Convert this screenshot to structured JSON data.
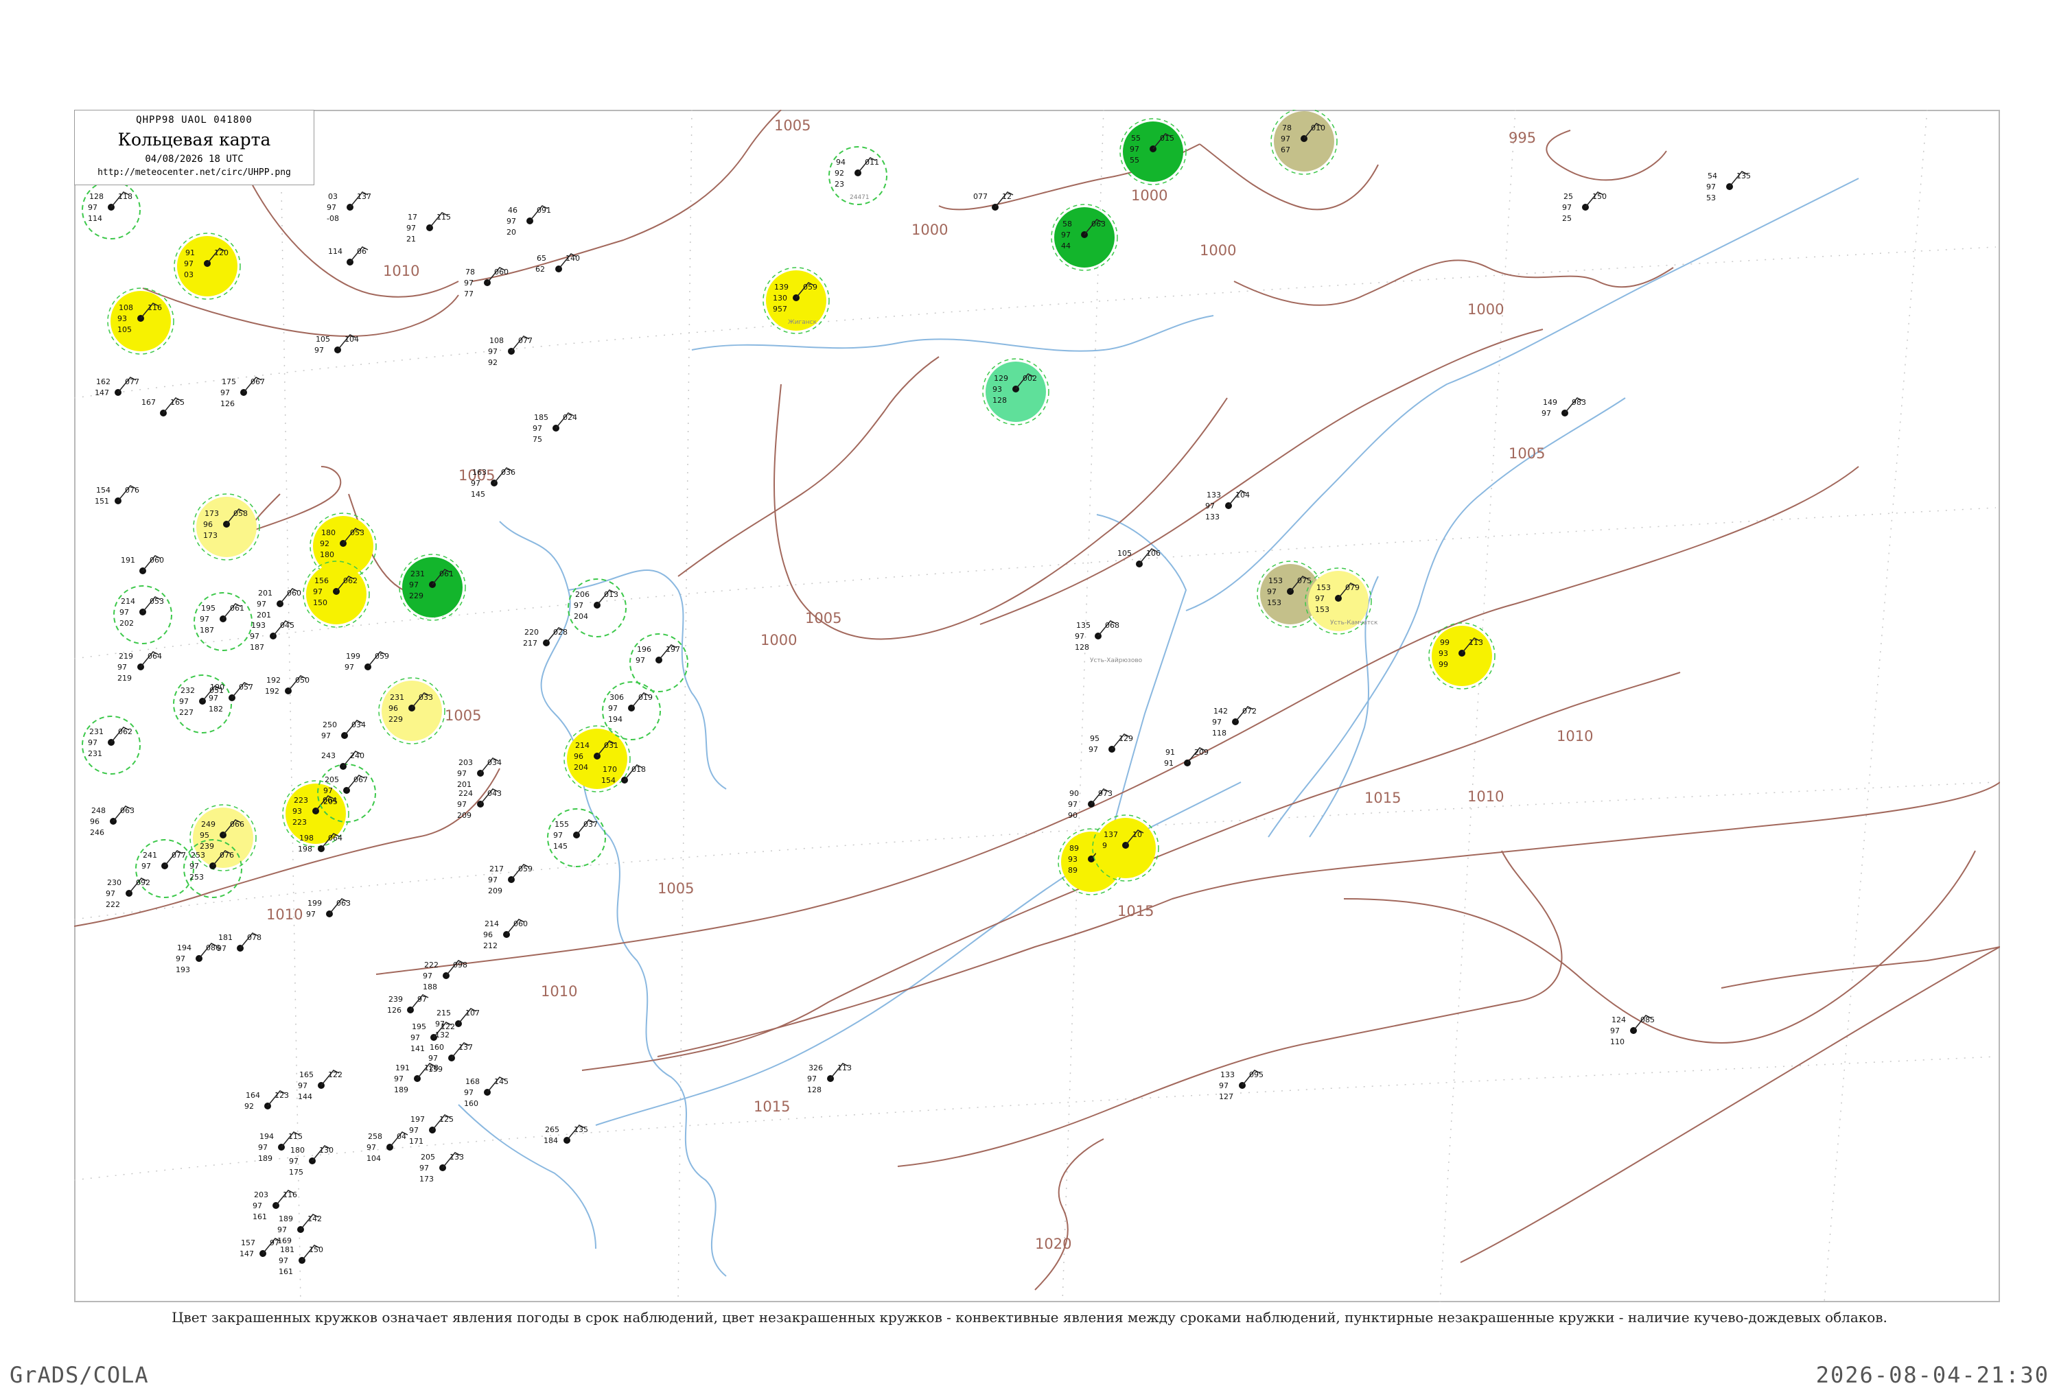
{
  "legend": {
    "code": "QHPP98  UAOL  041800",
    "title": "Кольцевая карта",
    "date": "04/08/2026 18 UTC",
    "url": "http://meteocenter.net/circ/UHPP.png"
  },
  "footnote": "Цвет закрашенных кружков означает явления погоды в срок наблюдений, цвет незакрашенных кружков - конвективные явления между сроками наблюдений, пунктирные незакрашенные кружки - наличие кучево-дождевых облаков.",
  "brand": "GrADS/COLA",
  "timestamp": "2026-08-04-21:30",
  "colors": {
    "isobar": "#a2685c",
    "river": "#8ab8e0",
    "frame": "#b8b8b8",
    "yellow_fill": "#f7f200",
    "pale_yellow_fill": "#fbf68a",
    "green_fill": "#13b52c",
    "mint_fill": "#5fe09a",
    "olive_fill": "#c4c08a",
    "dashed_ring": "#3cc84a"
  },
  "isobar_labels": [
    {
      "text": "1005"
    },
    {
      "text": "995"
    },
    {
      "text": "1000"
    },
    {
      "text": "1000"
    },
    {
      "text": "1000"
    },
    {
      "text": "1000"
    },
    {
      "text": "1010"
    },
    {
      "text": "1005"
    },
    {
      "text": "1005"
    },
    {
      "text": "1000"
    },
    {
      "text": "1005"
    },
    {
      "text": "1005"
    },
    {
      "text": "1010"
    },
    {
      "text": "1015"
    },
    {
      "text": "1010"
    },
    {
      "text": "1015"
    },
    {
      "text": "1015"
    },
    {
      "text": "1020"
    },
    {
      "text": "1010"
    },
    {
      "text": "1010"
    },
    {
      "text": "1005"
    }
  ],
  "stations": [
    {
      "name": "24471",
      "v1": "94",
      "v2": "011",
      "v3": "92",
      "v4": "23",
      "circle": "dashed"
    },
    {
      "name": "",
      "v1": "91",
      "v2": "120",
      "v3": "97",
      "v4": "03",
      "circle": "yellow"
    },
    {
      "name": "",
      "v1": "108",
      "v2": "116",
      "v3": "93",
      "v4": "105",
      "circle": "yellow"
    },
    {
      "name": "Жиганск",
      "v1": "139",
      "v2": "059",
      "v3": "130",
      "v4": "957",
      "circle": "yellow"
    },
    {
      "name": "",
      "v1": "129",
      "v2": "002",
      "v3": "93",
      "v4": "128",
      "circle": "mint"
    },
    {
      "name": "",
      "v1": "173",
      "v2": "058",
      "v3": "96",
      "v4": "173",
      "circle": "pale"
    },
    {
      "name": "",
      "v1": "180",
      "v2": "053",
      "v3": "92",
      "v4": "180",
      "circle": "yellow"
    },
    {
      "name": "",
      "v1": "156",
      "v2": "062",
      "v3": "97",
      "v4": "150",
      "circle": "yellow"
    },
    {
      "name": "",
      "v1": "231",
      "v2": "061",
      "v3": "97",
      "v4": "229",
      "circle": "green"
    },
    {
      "name": "",
      "v1": "231",
      "v2": "033",
      "v3": "96",
      "v4": "229",
      "circle": "pale"
    },
    {
      "name": "",
      "v1": "214",
      "v2": "031",
      "v3": "96",
      "v4": "204",
      "circle": "yellow"
    },
    {
      "name": "",
      "v1": "223",
      "v2": "064",
      "v3": "93",
      "v4": "223",
      "circle": "yellow"
    },
    {
      "name": "",
      "v1": "249",
      "v2": "066",
      "v3": "95",
      "v4": "239",
      "circle": "pale"
    },
    {
      "name": "",
      "v1": "55",
      "v2": "015",
      "v3": "97",
      "v4": "55",
      "circle": "green"
    },
    {
      "name": "",
      "v1": "58",
      "v2": "063",
      "v3": "97",
      "v4": "44",
      "circle": "green"
    },
    {
      "name": "",
      "v1": "78",
      "v2": "010",
      "v3": "97",
      "v4": "67",
      "circle": "olive"
    },
    {
      "name": "",
      "v1": "153",
      "v2": "075",
      "v3": "97",
      "v4": "153",
      "circle": "olive"
    },
    {
      "name": "Усть-Камчатск",
      "v1": "153",
      "v2": "079",
      "v3": "97",
      "v4": "153",
      "circle": "pale"
    },
    {
      "name": "",
      "v1": "99",
      "v2": "113",
      "v3": "93",
      "v4": "99",
      "circle": "yellow"
    },
    {
      "name": "",
      "v1": "89",
      "v2": "140",
      "v3": "93",
      "v4": "89",
      "circle": "yellow"
    },
    {
      "name": "",
      "v1": "137",
      "v2": "10",
      "v3": "9",
      "v4": "",
      "circle": "yellow"
    },
    {
      "name": "",
      "v1": "128",
      "v2": "118",
      "v3": "97",
      "v4": "114",
      "circle": "dashed"
    },
    {
      "name": "",
      "v1": "206",
      "v2": "013",
      "v3": "97",
      "v4": "204",
      "circle": "dashed"
    },
    {
      "name": "",
      "v1": "306",
      "v2": "019",
      "v3": "97",
      "v4": "194",
      "circle": "dashed"
    },
    {
      "name": "",
      "v1": "195",
      "v2": "061",
      "v3": "97",
      "v4": "187",
      "circle": "dashed"
    },
    {
      "name": "",
      "v1": "214",
      "v2": "053",
      "v3": "97",
      "v4": "202",
      "circle": "dashed"
    },
    {
      "name": "",
      "v1": "232",
      "v2": "051",
      "v3": "97",
      "v4": "227",
      "circle": "dashed"
    },
    {
      "name": "",
      "v1": "231",
      "v2": "062",
      "v3": "97",
      "v4": "231",
      "circle": "dashed"
    },
    {
      "name": "",
      "v1": "241",
      "v2": "077",
      "v3": "97",
      "v4": "",
      "circle": "dashed"
    },
    {
      "name": "",
      "v1": "253",
      "v2": "076",
      "v3": "97",
      "v4": "253",
      "circle": "dashed"
    },
    {
      "name": "",
      "v1": "155",
      "v2": "037",
      "v3": "97",
      "v4": "145",
      "circle": "dashed"
    },
    {
      "name": "",
      "v1": "205",
      "v2": "067",
      "v3": "97",
      "v4": "205",
      "circle": "dashed"
    },
    {
      "name": "",
      "v1": "196",
      "v2": "197",
      "v3": "97",
      "v4": "",
      "circle": "dashed"
    },
    {
      "name": "",
      "v1": "162",
      "v2": "077",
      "v3": "147",
      "v4": "",
      "circle": "none"
    },
    {
      "name": "",
      "v1": "167",
      "v2": "165",
      "v3": "",
      "v4": "",
      "circle": "none"
    },
    {
      "name": "",
      "v1": "175",
      "v2": "067",
      "v3": "97",
      "v4": "126",
      "circle": "none"
    },
    {
      "name": "",
      "v1": "105",
      "v2": "104",
      "v3": "97",
      "v4": "",
      "circle": "none"
    },
    {
      "name": "",
      "v1": "108",
      "v2": "077",
      "v3": "97",
      "v4": "92",
      "circle": "none"
    },
    {
      "name": "",
      "v1": "185",
      "v2": "024",
      "v3": "97",
      "v4": "75",
      "circle": "none"
    },
    {
      "name": "",
      "v1": "163",
      "v2": "036",
      "v3": "97",
      "v4": "145",
      "circle": "none"
    },
    {
      "name": "",
      "v1": "154",
      "v2": "076",
      "v3": "151",
      "v4": "",
      "circle": "none"
    },
    {
      "name": "",
      "v1": "191",
      "v2": "060",
      "v3": "",
      "v4": "",
      "circle": "none"
    },
    {
      "name": "",
      "v1": "201",
      "v2": "060",
      "v3": "97",
      "v4": "201",
      "circle": "none"
    },
    {
      "name": "",
      "v1": "219",
      "v2": "064",
      "v3": "97",
      "v4": "219",
      "circle": "none"
    },
    {
      "name": "",
      "v1": "190",
      "v2": "057",
      "v3": "97",
      "v4": "182",
      "circle": "none"
    },
    {
      "name": "",
      "v1": "193",
      "v2": "045",
      "v3": "97",
      "v4": "187",
      "circle": "none"
    },
    {
      "name": "",
      "v1": "199",
      "v2": "059",
      "v3": "97",
      "v4": "",
      "circle": "none"
    },
    {
      "name": "",
      "v1": "220",
      "v2": "028",
      "v3": "217",
      "v4": "",
      "circle": "none"
    },
    {
      "name": "",
      "v1": "192",
      "v2": "050",
      "v3": "192",
      "v4": "",
      "circle": "none"
    },
    {
      "name": "",
      "v1": "250",
      "v2": "034",
      "v3": "97",
      "v4": "",
      "circle": "none"
    },
    {
      "name": "",
      "v1": "243",
      "v2": "240",
      "v3": "",
      "v4": "",
      "circle": "none"
    },
    {
      "name": "",
      "v1": "248",
      "v2": "063",
      "v3": "96",
      "v4": "246",
      "circle": "none"
    },
    {
      "name": "",
      "v1": "230",
      "v2": "092",
      "v3": "97",
      "v4": "222",
      "circle": "none"
    },
    {
      "name": "",
      "v1": "203",
      "v2": "034",
      "v3": "97",
      "v4": "201",
      "circle": "none"
    },
    {
      "name": "",
      "v1": "224",
      "v2": "043",
      "v3": "97",
      "v4": "209",
      "circle": "none"
    },
    {
      "name": "",
      "v1": "170",
      "v2": "018",
      "v3": "154",
      "v4": "",
      "circle": "none"
    },
    {
      "name": "",
      "v1": "198",
      "v2": "064",
      "v3": "198",
      "v4": "",
      "circle": "none"
    },
    {
      "name": "",
      "v1": "217",
      "v2": "059",
      "v3": "97",
      "v4": "209",
      "circle": "none"
    },
    {
      "name": "",
      "v1": "199",
      "v2": "063",
      "v3": "97",
      "v4": "",
      "circle": "none"
    },
    {
      "name": "",
      "v1": "214",
      "v2": "060",
      "v3": "96",
      "v4": "212",
      "circle": "none"
    },
    {
      "name": "",
      "v1": "194",
      "v2": "086",
      "v3": "97",
      "v4": "193",
      "circle": "none"
    },
    {
      "name": "",
      "v1": "181",
      "v2": "078",
      "v3": "97",
      "v4": "",
      "circle": "none"
    },
    {
      "name": "",
      "v1": "222",
      "v2": "098",
      "v3": "97",
      "v4": "188",
      "circle": "none"
    },
    {
      "name": "",
      "v1": "239",
      "v2": "97",
      "v3": "126",
      "v4": "",
      "circle": "none"
    },
    {
      "name": "",
      "v1": "195",
      "v2": "122",
      "v3": "97",
      "v4": "141",
      "circle": "none"
    },
    {
      "name": "",
      "v1": "215",
      "v2": "107",
      "v3": "97",
      "v4": "132",
      "circle": "none"
    },
    {
      "name": "",
      "v1": "160",
      "v2": "137",
      "v3": "97",
      "v4": "159",
      "circle": "none"
    },
    {
      "name": "",
      "v1": "191",
      "v2": "128",
      "v3": "97",
      "v4": "189",
      "circle": "none"
    },
    {
      "name": "",
      "v1": "164",
      "v2": "123",
      "v3": "92",
      "v4": "",
      "circle": "none"
    },
    {
      "name": "",
      "v1": "165",
      "v2": "122",
      "v3": "97",
      "v4": "144",
      "circle": "none"
    },
    {
      "name": "",
      "v1": "168",
      "v2": "145",
      "v3": "97",
      "v4": "160",
      "circle": "none"
    },
    {
      "name": "",
      "v1": "197",
      "v2": "125",
      "v3": "97",
      "v4": "171",
      "circle": "none"
    },
    {
      "name": "",
      "v1": "205",
      "v2": "133",
      "v3": "97",
      "v4": "173",
      "circle": "none"
    },
    {
      "name": "",
      "v1": "194",
      "v2": "115",
      "v3": "97",
      "v4": "189",
      "circle": "none"
    },
    {
      "name": "",
      "v1": "180",
      "v2": "130",
      "v3": "97",
      "v4": "175",
      "circle": "none"
    },
    {
      "name": "",
      "v1": "203",
      "v2": "116",
      "v3": "97",
      "v4": "161",
      "circle": "none"
    },
    {
      "name": "",
      "v1": "189",
      "v2": "142",
      "v3": "97",
      "v4": "169",
      "circle": "none"
    },
    {
      "name": "",
      "v1": "157",
      "v2": "97",
      "v3": "147",
      "v4": "",
      "circle": "none"
    },
    {
      "name": "",
      "v1": "181",
      "v2": "150",
      "v3": "97",
      "v4": "161",
      "circle": "none"
    },
    {
      "name": "",
      "v1": "258",
      "v2": "04",
      "v3": "97",
      "v4": "104",
      "circle": "none"
    },
    {
      "name": "",
      "v1": "265",
      "v2": "135",
      "v3": "184",
      "v4": "",
      "circle": "none"
    },
    {
      "name": "",
      "v1": "326",
      "v2": "113",
      "v3": "97",
      "v4": "128",
      "circle": "none"
    },
    {
      "name": "",
      "v1": "133",
      "v2": "095",
      "v3": "97",
      "v4": "127",
      "circle": "none"
    },
    {
      "name": "",
      "v1": "124",
      "v2": "085",
      "v3": "97",
      "v4": "110",
      "circle": "none"
    },
    {
      "name": "",
      "v1": "142",
      "v2": "072",
      "v3": "97",
      "v4": "118",
      "circle": "none"
    },
    {
      "name": "Усть-Хайрюзово",
      "v1": "135",
      "v2": "068",
      "v3": "97",
      "v4": "128",
      "circle": "none"
    },
    {
      "name": "",
      "v1": "105",
      "v2": "106",
      "v3": "",
      "v4": "",
      "circle": "none"
    },
    {
      "name": "",
      "v1": "133",
      "v2": "104",
      "v3": "97",
      "v4": "133",
      "circle": "none"
    },
    {
      "name": "",
      "v1": "95",
      "v2": "129",
      "v3": "97",
      "v4": "",
      "circle": "none"
    },
    {
      "name": "",
      "v1": "91",
      "v2": "209",
      "v3": "91",
      "v4": "",
      "circle": "none"
    },
    {
      "name": "",
      "v1": "90",
      "v2": "973",
      "v3": "97",
      "v4": "90",
      "circle": "none"
    },
    {
      "name": "",
      "v1": "149",
      "v2": "983",
      "v3": "97",
      "v4": "",
      "circle": "none"
    },
    {
      "name": "",
      "v1": "25",
      "v2": "150",
      "v3": "97",
      "v4": "25",
      "circle": "none"
    },
    {
      "name": "",
      "v1": "54",
      "v2": "135",
      "v3": "97",
      "v4": "53",
      "circle": "none"
    },
    {
      "name": "",
      "v1": "03",
      "v2": "137",
      "v3": "97",
      "v4": "-08",
      "circle": "none"
    },
    {
      "name": "",
      "v1": "114",
      "v2": "06",
      "v3": "",
      "v4": "",
      "circle": "none"
    },
    {
      "name": "",
      "v1": "17",
      "v2": "115",
      "v3": "97",
      "v4": "21",
      "circle": "none"
    },
    {
      "name": "",
      "v1": "46",
      "v2": "091",
      "v3": "97",
      "v4": "20",
      "circle": "none"
    },
    {
      "name": "",
      "v1": "78",
      "v2": "060",
      "v3": "97",
      "v4": "77",
      "circle": "none"
    },
    {
      "name": "",
      "v1": "65",
      "v2": "140",
      "v3": "62",
      "v4": "",
      "circle": "none"
    },
    {
      "name": "",
      "v1": "077",
      "v2": "12",
      "v3": "",
      "v4": "",
      "circle": "none"
    }
  ]
}
